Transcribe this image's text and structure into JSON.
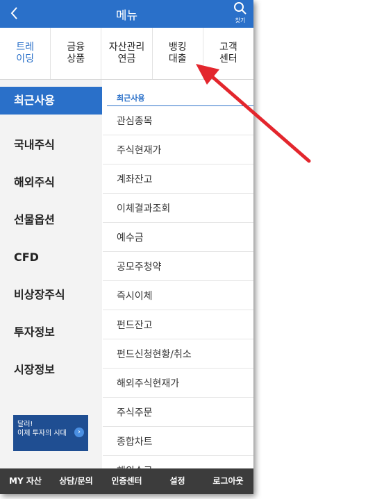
{
  "header": {
    "title": "메뉴",
    "search_label": "찾기"
  },
  "tabs": [
    {
      "label": "트레\n이딩",
      "active": true
    },
    {
      "label": "금융\n상품",
      "active": false
    },
    {
      "label": "자산관리\n연금",
      "active": false
    },
    {
      "label": "뱅킹\n대출",
      "active": false
    },
    {
      "label": "고객\n센터",
      "active": false
    }
  ],
  "sidebar": {
    "items": [
      {
        "label": "최근사용",
        "active": true
      },
      {
        "label": "국내주식",
        "active": false
      },
      {
        "label": "해외주식",
        "active": false
      },
      {
        "label": "선물옵션",
        "active": false
      },
      {
        "label": "CFD",
        "active": false
      },
      {
        "label": "비상장주식",
        "active": false
      },
      {
        "label": "투자정보",
        "active": false
      },
      {
        "label": "시장정보",
        "active": false
      }
    ],
    "banner": {
      "line1": "달러!",
      "line2": "이제 투자의 시대"
    }
  },
  "content": {
    "section_title": "최근사용",
    "items": [
      "관심종목",
      "주식현재가",
      "계좌잔고",
      "이체결과조회",
      "예수금",
      "공모주청약",
      "즉시이체",
      "펀드잔고",
      "펀드신청현황/취소",
      "해외주식현재가",
      "주식주문",
      "종합차트",
      "해외수료"
    ]
  },
  "bottombar": [
    "MY 자산",
    "상담/문의",
    "인증센터",
    "설정",
    "로그아웃"
  ],
  "colors": {
    "accent": "#2a70c9",
    "annotation_arrow": "#e3262d",
    "bottom_bar": "#3c3c3c"
  }
}
